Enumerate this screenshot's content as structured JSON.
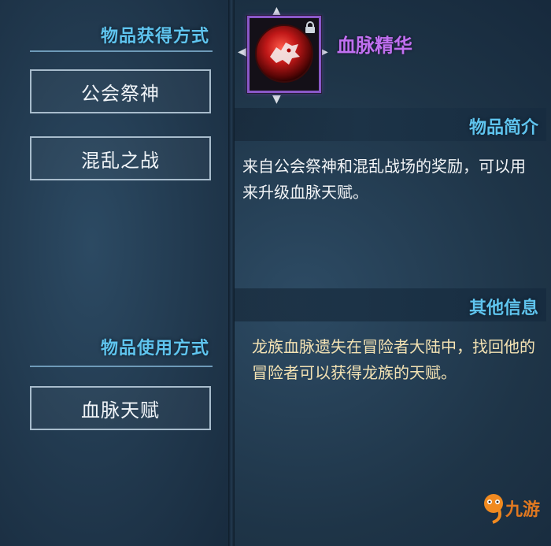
{
  "left": {
    "obtain_title": "物品获得方式",
    "obtain_buttons": [
      "公会祭神",
      "混乱之战"
    ],
    "use_title": "物品使用方式",
    "use_buttons": [
      "血脉天赋"
    ]
  },
  "item": {
    "name": "血脉精华",
    "icon": "crimson-beast-orb-icon",
    "locked": true,
    "frame_color": "#8a58c8",
    "name_color": "#c070f0"
  },
  "intro": {
    "title": "物品简介",
    "text": "来自公会祭神和混乱战场的奖励，可以用来升级血脉天赋。"
  },
  "other": {
    "title": "其他信息",
    "text": "龙族血脉遗失在冒险者大陆中，找回他的冒险者可以获得龙族的天赋。"
  },
  "watermark": {
    "text": "九游"
  },
  "colors": {
    "accent": "#5fc4ee",
    "gold_text": "#f3e2b3"
  }
}
